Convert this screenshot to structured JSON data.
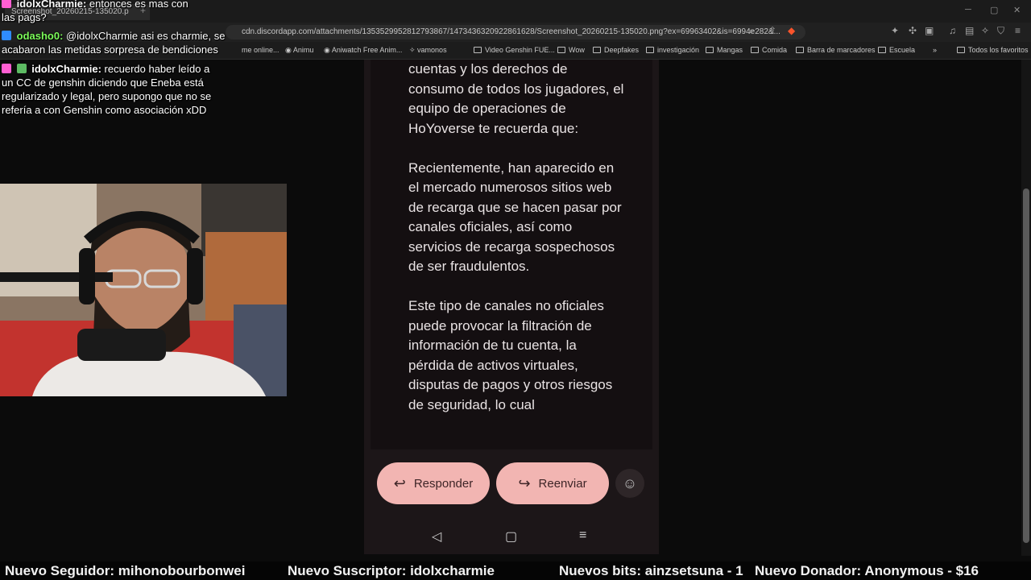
{
  "browser": {
    "tab_title": "Screenshot_20260215-135020.p",
    "url": "cdn.discordapp.com/attachments/1353529952812793867/1473436320922861628/Screenshot_20260215-135020.png?ex=69963402&is=6994e282&...",
    "bookmarks": [
      "me online...",
      "Animu",
      "Aniwatch Free Anim...",
      "vamonos",
      "Video Genshin FUE...",
      "Wow",
      "Deepfakes",
      "investigación",
      "Mangas",
      "Comida",
      "Barra de marcadores",
      "Escuela",
      "Todos los favoritos"
    ]
  },
  "chat": {
    "messages": [
      {
        "user": "idolxCharmie:",
        "text": " entonces es mas con"
      },
      {
        "user": "",
        "text": "las pags?"
      },
      {
        "user": "odasho0:",
        "text": " @idolxCharmie asi es charmie, se"
      },
      {
        "user": "",
        "text": "acabaron las metidas sorpresa de bendiciones"
      },
      {
        "user": "idolxCharmie:",
        "text": " recuerdo haber leído a"
      },
      {
        "user": "",
        "text": "un CC de genshin diciendo que Eneba está"
      },
      {
        "user": "",
        "text": "regularizado y legal, pero supongo que no se"
      },
      {
        "user": "",
        "text": "refería a con Genshin como asociación xDD"
      }
    ]
  },
  "phone": {
    "paragraphs": [
      "cuentas y los derechos de consumo de todos los jugadores, el equipo de operaciones de HoYoverse te recuerda que:",
      "Recientemente, han aparecido en el mercado numerosos sitios web de recarga que se hacen pasar por canales oficiales, así como servicios de recarga sospechosos de ser fraudulentos.",
      "Este tipo de canales no oficiales puede provocar la filtración de información de tu cuenta, la pérdida de activos virtuales, disputas de pagos y otros riesgos de seguridad, lo cual"
    ],
    "reply_label": "Responder",
    "forward_label": "Reenviar"
  },
  "ticker": {
    "follower": "Nuevo Seguidor: mihonobourbonwei",
    "subscriber": "Nuevo Suscriptor: idolxcharmie",
    "bits": "Nuevos bits: ainzsetsuna - 1",
    "donor": "Nuevo Donador: Anonymous - $16"
  },
  "colors": {
    "button_bg": "#f2b5b2",
    "username_green": "#7cfc5a",
    "chat_badge_pink": "#ff5fd2"
  }
}
